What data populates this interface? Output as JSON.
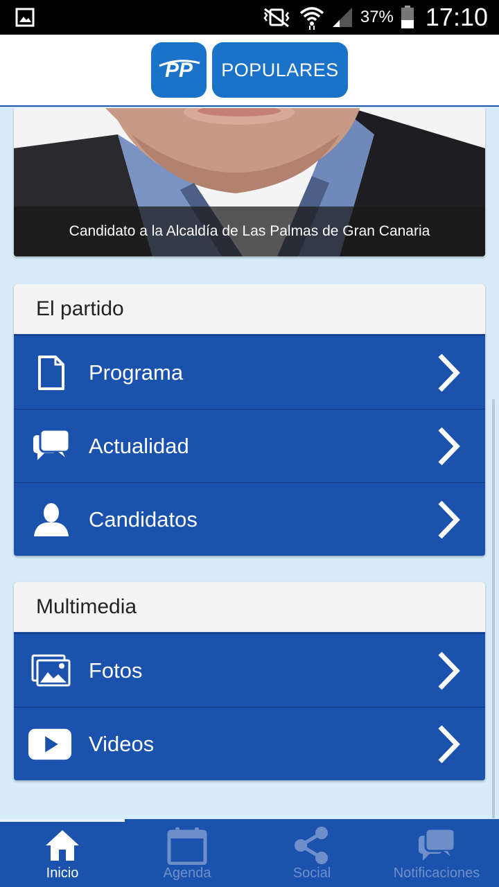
{
  "status_bar": {
    "battery": "37%",
    "time": "17:10",
    "icons": [
      "gallery-icon",
      "vibrate-mute-icon",
      "wifi-icon",
      "signal-icon",
      "battery-icon"
    ]
  },
  "header": {
    "logo_text": "PP",
    "brand_text": "POPULARES"
  },
  "hero": {
    "caption": "Candidato a la Alcaldía de Las Palmas de Gran Canaria"
  },
  "sections": [
    {
      "title": "El partido",
      "items": [
        {
          "label": "Programa",
          "icon": "document-icon"
        },
        {
          "label": "Actualidad",
          "icon": "chat-bubbles-icon"
        },
        {
          "label": "Candidatos",
          "icon": "person-icon"
        }
      ]
    },
    {
      "title": "Multimedia",
      "items": [
        {
          "label": "Fotos",
          "icon": "photos-icon"
        },
        {
          "label": "Videos",
          "icon": "video-play-icon"
        }
      ]
    }
  ],
  "tabs": [
    {
      "label": "Inicio",
      "icon": "home-icon",
      "active": true
    },
    {
      "label": "Agenda",
      "icon": "calendar-icon",
      "active": false
    },
    {
      "label": "Social",
      "icon": "share-icon",
      "active": false
    },
    {
      "label": "Notificaciones",
      "icon": "notifications-chat-icon",
      "active": false
    }
  ],
  "colors": {
    "primary": "#1a52ad",
    "brand": "#1a73c9",
    "background": "#d7ecf8",
    "inactive_tab": "#6f8fcb"
  }
}
